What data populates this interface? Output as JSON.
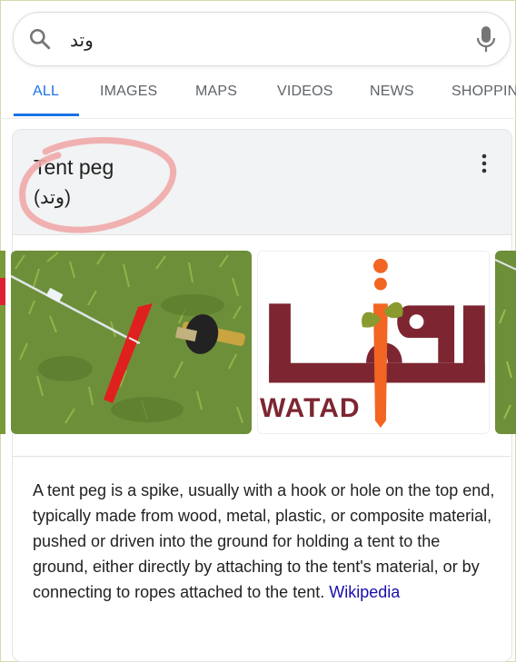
{
  "search": {
    "query": "وتد"
  },
  "tabs": [
    {
      "label": "ALL",
      "active": true
    },
    {
      "label": "IMAGES"
    },
    {
      "label": "MAPS"
    },
    {
      "label": "VIDEOS"
    },
    {
      "label": "NEWS"
    },
    {
      "label": "SHOPPIN"
    }
  ],
  "card": {
    "title": "Tent peg",
    "subtitle": "(وتد)",
    "logo_text": "WATAD",
    "description": "A tent peg is a spike, usually with a hook or hole on the top end, typically made from wood, metal, plastic, or composite material, pushed or driven into the ground for holding a tent to the ground, either directly by attaching to the tent's material, or by connecting to ropes attached to the tent.",
    "source_link": "Wikipedia"
  },
  "colors": {
    "accent": "#1a73e8",
    "link": "#1a0dab",
    "annotation": "#f1a8a8"
  },
  "icons": [
    "search-icon",
    "mic-icon",
    "more-vert-icon"
  ]
}
